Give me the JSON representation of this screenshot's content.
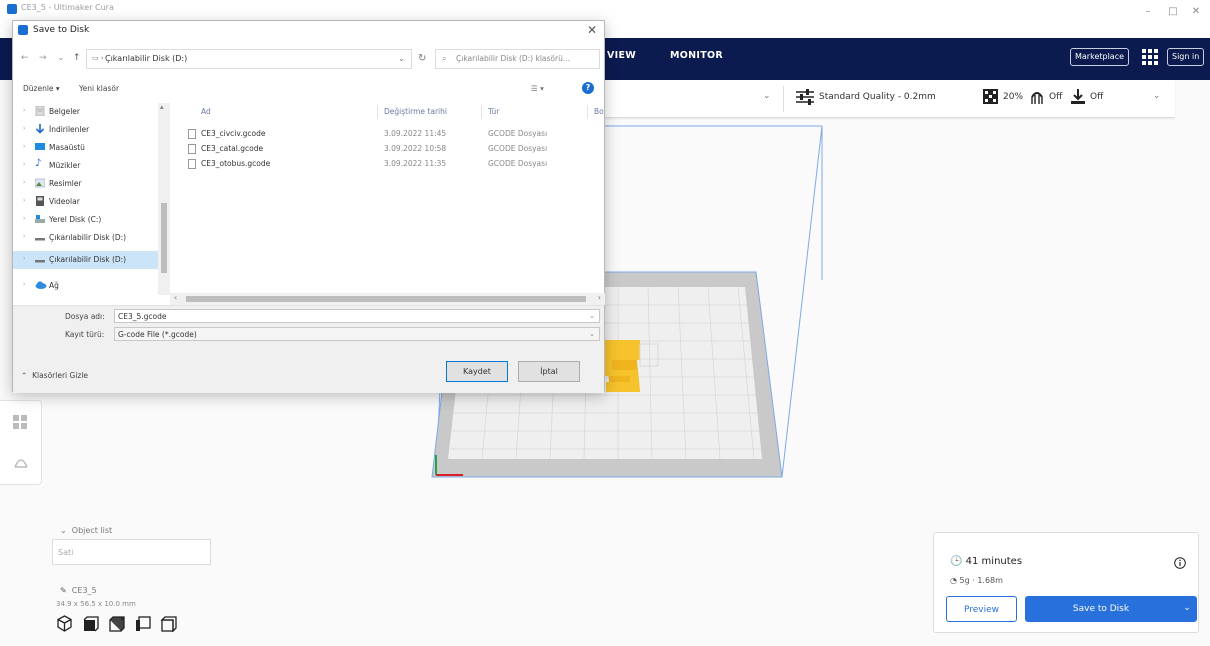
{
  "app": {
    "title": "CE3_5 - Ultimaker Cura",
    "window_controls": [
      "–",
      "□",
      "✕"
    ]
  },
  "header": {
    "stages": [
      "VIEW",
      "MONITOR"
    ],
    "marketplace_label": "Marketplace",
    "signin_label": "Sign in"
  },
  "settings_bar": {
    "profile": "Standard Quality - 0.2mm",
    "infill": "20%",
    "support": "Off",
    "adhesion": "Off"
  },
  "object_list": {
    "toggle_label": "Object list",
    "filter_value": "Sati",
    "object_name": "CE3_5",
    "dimensions": "34.9 x 56.5 x 10.0 mm"
  },
  "action_panel": {
    "print_time": "41 minutes",
    "material": "5g · 1.68m",
    "preview_label": "Preview",
    "save_label": "Save to Disk"
  },
  "dialog": {
    "title": "Save to Disk",
    "address": "Çıkarılabilir Disk (D:)",
    "search_placeholder": "Çıkarılabilir Disk (D:) klasörü...",
    "organize_label": "Düzenle ▾",
    "new_folder_label": "Yeni klasör",
    "nav_items": [
      {
        "label": "Belgeler",
        "icon": "documents-icon"
      },
      {
        "label": "İndirilenler",
        "icon": "downloads-icon"
      },
      {
        "label": "Masaüstü",
        "icon": "desktop-icon"
      },
      {
        "label": "Müzikler",
        "icon": "music-icon"
      },
      {
        "label": "Resimler",
        "icon": "pictures-icon"
      },
      {
        "label": "Videolar",
        "icon": "videos-icon"
      },
      {
        "label": "Yerel Disk (C:)",
        "icon": "local-disk-icon"
      },
      {
        "label": "Çıkarılabilir Disk (D:)",
        "icon": "removable-disk-icon"
      },
      {
        "label": "Çıkarılabilir Disk (D:)",
        "icon": "removable-disk-icon"
      },
      {
        "label": "Ağ",
        "icon": "network-icon"
      }
    ],
    "columns": {
      "name": "Ad",
      "date": "Değiştirme tarihi",
      "type": "Tür",
      "size": "Bo"
    },
    "files": [
      {
        "name": "CE3_civciv.gcode",
        "date": "3.09.2022 11:45",
        "type": "GCODE Dosyası"
      },
      {
        "name": "CE3_catal.gcode",
        "date": "3.09.2022 10:58",
        "type": "GCODE Dosyası"
      },
      {
        "name": "CE3_otobus.gcode",
        "date": "3.09.2022 11:35",
        "type": "GCODE Dosyası"
      }
    ],
    "filename_label": "Dosya adı:",
    "filename_value": "CE3_5.gcode",
    "savetype_label": "Kayıt türü:",
    "savetype_value": "G-code File (*.gcode)",
    "hide_folders_label": "Klasörleri Gizle",
    "save_button": "Kaydet",
    "cancel_button": "İptal"
  },
  "colors": {
    "header_bg": "#0b1a4f",
    "accent": "#2871dd",
    "selection": "#cce4f7",
    "model_yellow": "#f6c32c"
  }
}
